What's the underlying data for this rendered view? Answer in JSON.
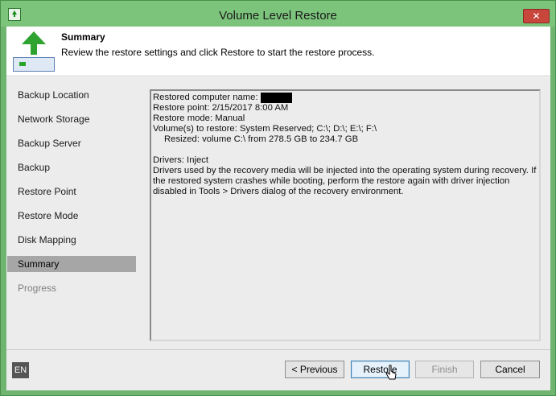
{
  "window": {
    "title": "Volume Level Restore",
    "close_label": "✕",
    "accent_color": "#7cc47c"
  },
  "header": {
    "title": "Summary",
    "subtitle": "Review the restore settings and click Restore to start the restore process.",
    "icon": "restore-volume-icon"
  },
  "steps": [
    {
      "label": "Backup Location",
      "state": "normal"
    },
    {
      "label": "Network Storage",
      "state": "normal"
    },
    {
      "label": "Backup Server",
      "state": "normal"
    },
    {
      "label": "Backup",
      "state": "normal"
    },
    {
      "label": "Restore Point",
      "state": "normal"
    },
    {
      "label": "Restore Mode",
      "state": "normal"
    },
    {
      "label": "Disk Mapping",
      "state": "normal"
    },
    {
      "label": "Summary",
      "state": "active"
    },
    {
      "label": "Progress",
      "state": "disabled"
    }
  ],
  "summary": {
    "computer_name_label": "Restored computer name:",
    "restore_point": "Restore point: 2/15/2017 8:00 AM",
    "restore_mode": "Restore mode: Manual",
    "volumes": "Volume(s) to restore: System Reserved; C:\\; D:\\; E:\\; F:\\",
    "resized": "Resized: volume C:\\ from 278.5 GB to 234.7 GB",
    "drivers": "Drivers: Inject",
    "drivers_note": "Drivers used by the recovery media will be injected into the operating system during recovery. If the restored system crashes while booting, perform the restore again with driver injection disabled in Tools > Drivers dialog of the recovery environment."
  },
  "footer": {
    "language": "EN",
    "previous_label": "< Previous",
    "restore_label": "Restore",
    "finish_label": "Finish",
    "cancel_label": "Cancel"
  }
}
